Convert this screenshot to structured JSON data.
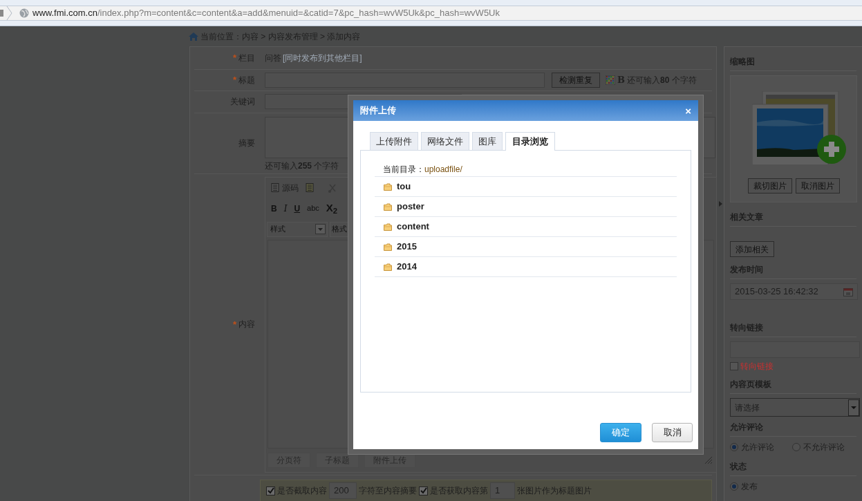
{
  "browser": {
    "url_host": "www.fmi.com.cn",
    "url_path": "/index.php?m=content&c=content&a=add&menuid=&catid=7&pc_hash=wvW5Uk&pc_hash=wvW5Uk"
  },
  "breadcrumb": "当前位置：内容 > 内容发布管理 > 添加内容",
  "form": {
    "required_mark": "*",
    "rows": [
      {
        "kind": "category",
        "label": "栏目",
        "required": true,
        "value": "问答",
        "hint": "[同时发布到其他栏目]"
      },
      {
        "kind": "title",
        "label": "标题",
        "required": true,
        "button": "检测重复",
        "bold_toggle": "B",
        "counter": "还可输入**80** 个字符"
      },
      {
        "kind": "keywords",
        "label": "关键词",
        "required": false
      },
      {
        "kind": "summary",
        "label": "摘要",
        "required": false,
        "counter": "还可输入**255** 个字符"
      },
      {
        "kind": "editor",
        "label": "内容",
        "required": true,
        "source": "源码",
        "format_buttons": [
          "B",
          "I",
          "U",
          "abc",
          "X$_{2}$"
        ],
        "selects": [
          "样式",
          "格式"
        ],
        "bottom_buttons": [
          "分页符",
          "子标题",
          "附件上传"
        ]
      }
    ],
    "options": {
      "truncate_checked": true,
      "truncate_label": "是否截取内容",
      "truncate_value": "200",
      "truncate_suffix": "字符至内容摘要",
      "image_checked": true,
      "image_label": "是否获取内容第",
      "image_value": "1",
      "image_suffix": "张图片作为标题图片"
    }
  },
  "sidebar": {
    "sections": [
      {
        "kind": "thumbnail",
        "title": "缩略图",
        "buttons": [
          "裁切图片",
          "取消图片"
        ]
      },
      {
        "kind": "button",
        "title": "相关文章",
        "button": "添加相关"
      },
      {
        "kind": "datetime",
        "title": "发布时间",
        "value": "2015-03-25 16:42:32"
      },
      {
        "kind": "link",
        "title": "转向链接",
        "checkbox_label": "转向链接",
        "checked": false
      },
      {
        "kind": "select",
        "title": "内容页模板",
        "value": "请选择"
      },
      {
        "kind": "radios",
        "title": "允许评论",
        "options": [
          {
            "label": "允许评论",
            "selected": true
          },
          {
            "label": "不允许评论",
            "selected": false
          }
        ]
      },
      {
        "kind": "radios",
        "title": "状态",
        "options": [
          {
            "label": "发布",
            "selected": true
          }
        ]
      }
    ]
  },
  "dialog": {
    "title": "附件上传",
    "close": "×",
    "tabs": [
      {
        "label": "上传附件",
        "selected": false
      },
      {
        "label": "网络文件",
        "selected": false
      },
      {
        "label": "图库",
        "selected": false
      },
      {
        "label": "目录浏览",
        "selected": true
      }
    ],
    "current_dir_label": "当前目录：",
    "current_dir": "uploadfile/",
    "folders": [
      "tou",
      "poster",
      "content",
      "2015",
      "2014"
    ],
    "buttons": [
      {
        "label": "确定",
        "kind": "primary"
      },
      {
        "label": "取消",
        "kind": "secondary"
      }
    ]
  }
}
